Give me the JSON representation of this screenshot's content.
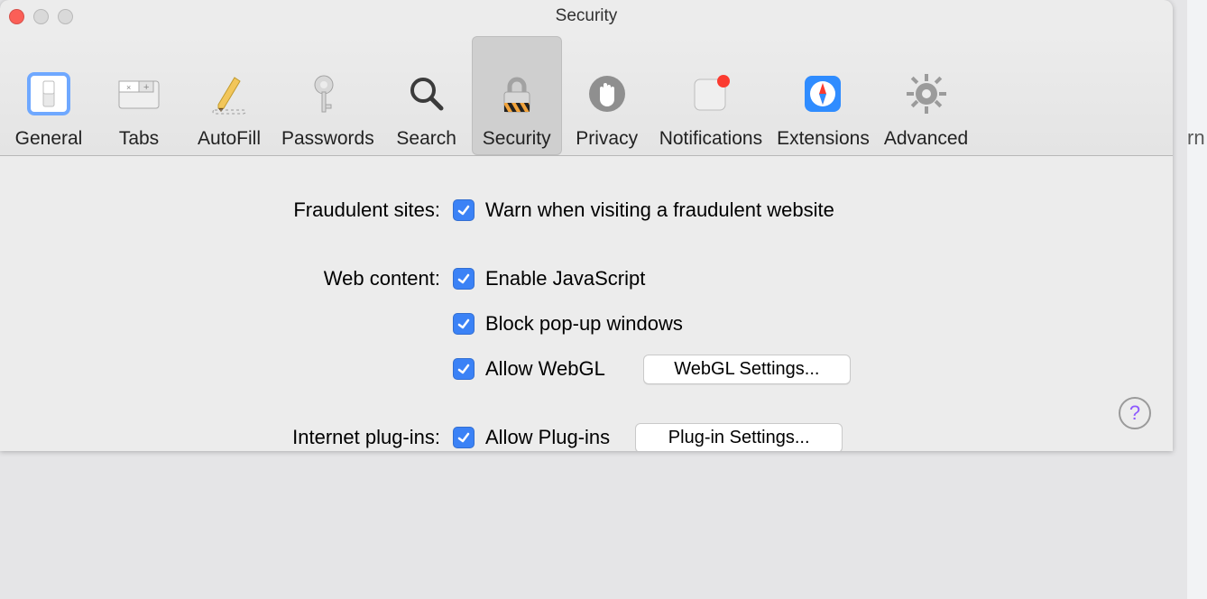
{
  "window_title": "Security",
  "toolbar": {
    "items": [
      {
        "label": "General"
      },
      {
        "label": "Tabs"
      },
      {
        "label": "AutoFill"
      },
      {
        "label": "Passwords"
      },
      {
        "label": "Search"
      },
      {
        "label": "Security"
      },
      {
        "label": "Privacy"
      },
      {
        "label": "Notifications"
      },
      {
        "label": "Extensions"
      },
      {
        "label": "Advanced"
      }
    ],
    "active_index": 5
  },
  "sections": {
    "fraud": {
      "label": "Fraudulent sites:",
      "warn": "Warn when visiting a fraudulent website"
    },
    "web": {
      "label": "Web content:",
      "js": "Enable JavaScript",
      "popup": "Block pop-up windows",
      "webgl": "Allow WebGL",
      "webgl_btn": "WebGL Settings..."
    },
    "plugins": {
      "label": "Internet plug-ins:",
      "allow": "Allow Plug-ins",
      "btn": "Plug-in Settings..."
    }
  },
  "background_text": "rn"
}
